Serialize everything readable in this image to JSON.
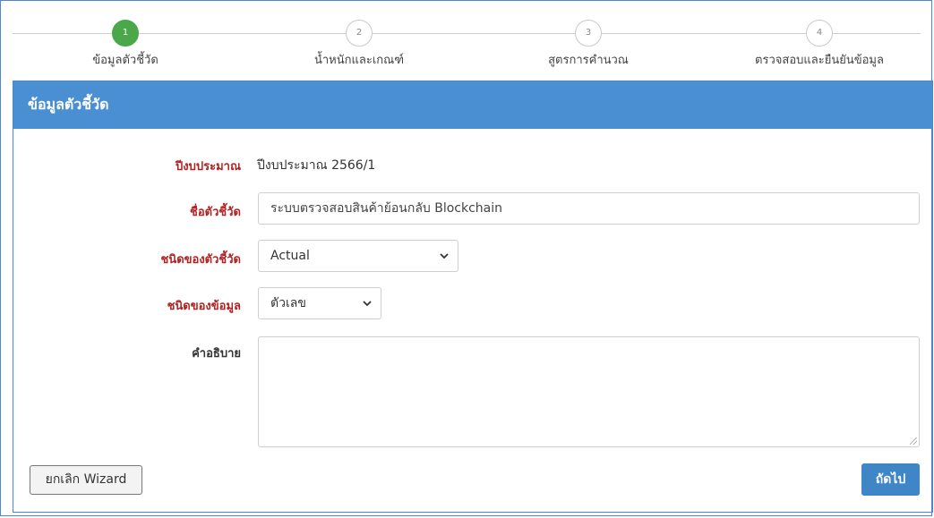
{
  "wizard": {
    "steps": [
      {
        "number": "1",
        "label": "ข้อมูลตัวชี้วัด"
      },
      {
        "number": "2",
        "label": "น้ำหนักและเกณฑ์"
      },
      {
        "number": "3",
        "label": "สูตรการคำนวณ"
      },
      {
        "number": "4",
        "label": "ตรวจสอบและยืนยันข้อมูล"
      }
    ],
    "active_step": "1"
  },
  "panel": {
    "title": "ข้อมูลตัวชี้วัด"
  },
  "form": {
    "fiscal_year": {
      "label": "ปีงบประมาณ",
      "value": "ปีงบประมาณ 2566/1"
    },
    "indicator_name": {
      "label": "ชื่อตัวชี้วัด",
      "value": "ระบบตรวจสอบสินค้าย้อนกลับ Blockchain"
    },
    "indicator_type": {
      "label": "ชนิดของตัวชี้วัด",
      "value": "Actual"
    },
    "data_type": {
      "label": "ชนิดของข้อมูล",
      "value": "ตัวเลข"
    },
    "description": {
      "label": "คำอธิบาย",
      "value": ""
    }
  },
  "buttons": {
    "cancel_label": "ยกเลิก Wizard",
    "next_label": "ถัดไป"
  },
  "colors": {
    "accent_blue": "#4a8fd1",
    "active_step_green": "#4aa84a",
    "required_label_red": "#b22222"
  },
  "icons": {
    "select_arrow": "chevron-down-icon"
  }
}
